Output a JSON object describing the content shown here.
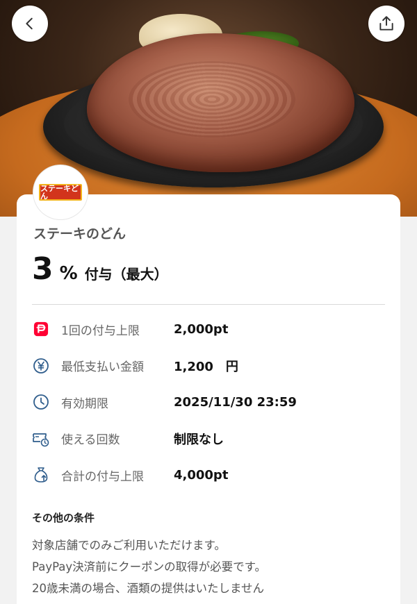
{
  "header": {
    "back_icon": "chevron-left-icon",
    "share_icon": "share-icon"
  },
  "store": {
    "logo_text": "ステーキどん",
    "name": "ステーキのどん"
  },
  "reward": {
    "number": "3",
    "unit": "%",
    "text": "付与（最大）"
  },
  "details": [
    {
      "icon": "paypay-icon",
      "label": "1回の付与上限",
      "value": "2,000pt"
    },
    {
      "icon": "yen-icon",
      "label": "最低支払い金額",
      "value": "1,200　円"
    },
    {
      "icon": "clock-icon",
      "label": "有効期限",
      "value": "2025/11/30 23:59"
    },
    {
      "icon": "ticket-clock-icon",
      "label": "使える回数",
      "value": "制限なし"
    },
    {
      "icon": "money-bag-icon",
      "label": "合計の付与上限",
      "value": "4,000pt"
    }
  ],
  "conditions": {
    "title": "その他の条件",
    "lines": [
      "対象店舗でのみご利用いただけます。",
      "PayPay決済前にクーポンの取得が必要です。",
      "20歳未満の場合、酒類の提供はいたしません"
    ]
  },
  "colors": {
    "paypay_red": "#ff0033",
    "icon_blue": "#2f5d8c",
    "logo_red": "#d2341c"
  }
}
